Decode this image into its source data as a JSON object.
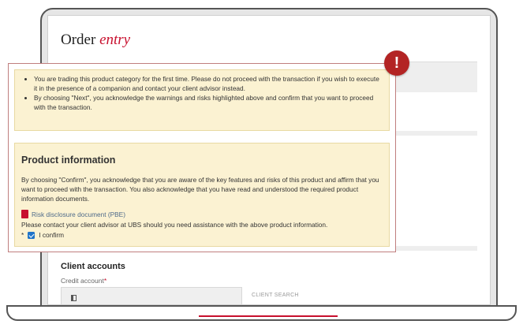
{
  "page": {
    "title_main": "Order",
    "title_emphasis": "entry"
  },
  "warning": {
    "badge": "!",
    "bullets": [
      "You are trading this product category for the first time. Please do not proceed with the transaction if you wish to execute it in the presence of a companion and contact your client advisor instead.",
      "By choosing \"Next\", you acknowledge the warnings and risks highlighted above and confirm that you want to proceed with the transaction."
    ]
  },
  "product_info": {
    "title": "Product information",
    "text": "By choosing \"Confirm\", you acknowledge that you are aware of the key features and risks of this product and affirm that you want to proceed with the transaction. You also acknowledge that you have read and understood the required product information documents.",
    "document_link": "Risk disclosure document (PBE)",
    "assistance": "Please contact your client advisor at UBS should you need assistance with the above product information.",
    "required_mark": "*",
    "confirm_label": "I confirm",
    "confirm_checked": true
  },
  "client_accounts": {
    "heading": "Client accounts",
    "credit_label": "Credit account",
    "required_mark": "*",
    "search_label": "CLIENT SEARCH"
  },
  "colors": {
    "accent": "#c8102e",
    "alert": "#b32424",
    "panel": "#fbf2d2",
    "checkbox": "#1f74c9"
  },
  "icons": {
    "alert": "exclamation-icon",
    "document": "pdf-icon",
    "account": "wallet-icon"
  }
}
